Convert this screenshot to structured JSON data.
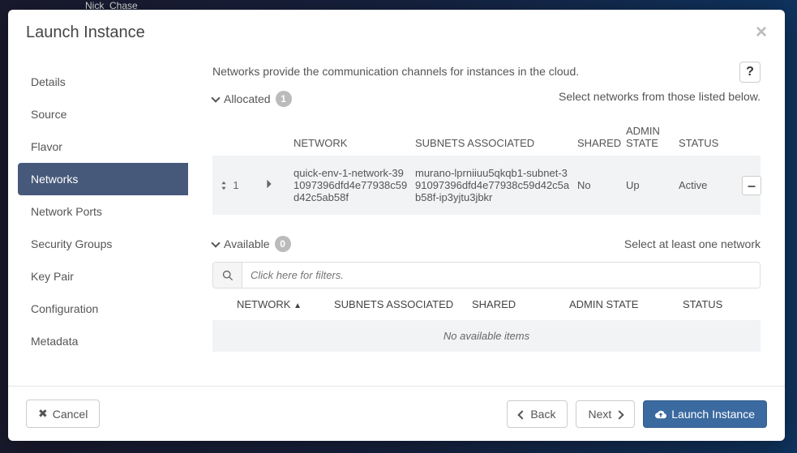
{
  "backdrop_user": "Nick_Chase",
  "modal": {
    "title": "Launch Instance"
  },
  "sidebar": {
    "items": [
      {
        "label": "Details",
        "active": false
      },
      {
        "label": "Source",
        "active": false
      },
      {
        "label": "Flavor",
        "active": false
      },
      {
        "label": "Networks",
        "active": true
      },
      {
        "label": "Network Ports",
        "active": false
      },
      {
        "label": "Security Groups",
        "active": false
      },
      {
        "label": "Key Pair",
        "active": false
      },
      {
        "label": "Configuration",
        "active": false
      },
      {
        "label": "Metadata",
        "active": false
      }
    ]
  },
  "main": {
    "description": "Networks provide the communication channels for instances in the cloud.",
    "hint": "Select networks from those listed below.",
    "allocated": {
      "label": "Allocated",
      "count": "1",
      "headers": {
        "network": "NETWORK",
        "subnets": "SUBNETS ASSOCIATED",
        "shared": "SHARED",
        "admin": "ADMIN STATE",
        "status": "STATUS"
      },
      "rows": [
        {
          "order": "1",
          "network": "quick-env-1-network-391097396dfd4e77938c59d42c5ab58f",
          "subnets": "murano-lprniiuu5qkqb1-subnet-391097396dfd4e77938c59d42c5ab58f-ip3yjtu3jbkr",
          "shared": "No",
          "admin": "Up",
          "status": "Active"
        }
      ]
    },
    "available": {
      "label": "Available",
      "count": "0",
      "hint": "Select at least one network",
      "filter_placeholder": "Click here for filters.",
      "headers": {
        "network": "NETWORK",
        "subnets": "SUBNETS ASSOCIATED",
        "shared": "SHARED",
        "admin": "ADMIN STATE",
        "status": "STATUS"
      },
      "empty": "No available items"
    }
  },
  "footer": {
    "cancel": "Cancel",
    "back": "Back",
    "next": "Next",
    "launch": "Launch Instance"
  }
}
